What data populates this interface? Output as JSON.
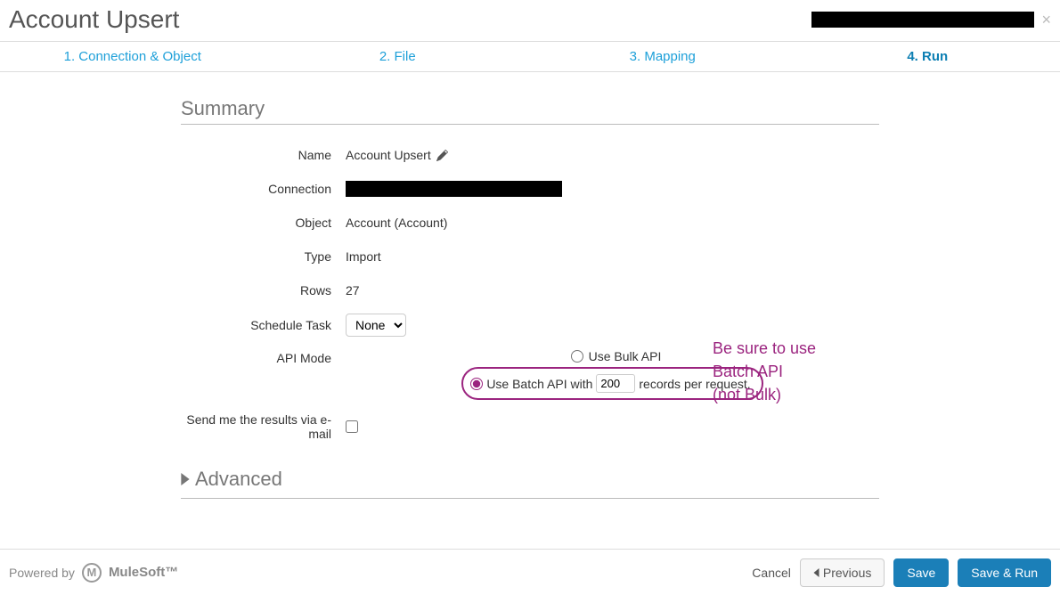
{
  "header": {
    "title": "Account Upsert"
  },
  "steps": {
    "s1": "1. Connection & Object",
    "s2": "2. File",
    "s3": "3. Mapping",
    "s4": "4. Run"
  },
  "summary": {
    "title": "Summary",
    "labels": {
      "name": "Name",
      "connection": "Connection",
      "object": "Object",
      "type": "Type",
      "rows": "Rows",
      "schedule": "Schedule Task",
      "api_mode": "API Mode",
      "email": "Send me the results via e-mail"
    },
    "values": {
      "name": "Account Upsert",
      "object": "Account (Account)",
      "type": "Import",
      "rows": "27",
      "schedule_selected": "None"
    },
    "api": {
      "bulk_label": "Use Bulk API",
      "batch_prefix": "Use Batch API with",
      "batch_value": "200",
      "batch_suffix": "records per request."
    }
  },
  "advanced": {
    "title": "Advanced"
  },
  "annotation": {
    "line1": "Be sure to use",
    "line2": "Batch API",
    "line3": "(not Bulk)"
  },
  "footer": {
    "powered": "Powered by",
    "brand": "MuleSoft™",
    "cancel": "Cancel",
    "previous": "Previous",
    "save": "Save",
    "save_run": "Save & Run"
  }
}
